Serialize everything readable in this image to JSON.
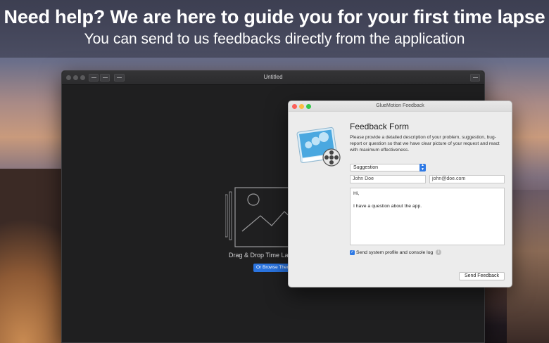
{
  "banner": {
    "headline": "Need help? We are here to guide you for your first time lapse",
    "subline": "You can send to us feedbacks directly from the application"
  },
  "app_window": {
    "title": "Untitled",
    "drop_label": "Drag & Drop Time Lapse",
    "browse_label": "Or Browse Them"
  },
  "dialog": {
    "title": "GlueMotion Feedback",
    "form_title": "Feedback Form",
    "description": "Please provide a detailed description of your problem, suggestion, bug-report or question so that we have clear picture of your request and react with maximum effectiveness.",
    "category": {
      "selected": "Suggestion"
    },
    "name_field": {
      "value": "John Doe"
    },
    "email_field": {
      "value": "john@doe.com"
    },
    "message_lines": [
      "Hi,",
      "",
      "I have a question about the app."
    ],
    "checkbox_label": "Send system profile and console log",
    "checkbox_checked": true,
    "send_label": "Send Feedback"
  },
  "colors": {
    "accent_blue": "#2f7ae5",
    "close_red": "#fc605b",
    "minimize_yellow": "#fdbc40",
    "zoom_green": "#34c84a"
  }
}
